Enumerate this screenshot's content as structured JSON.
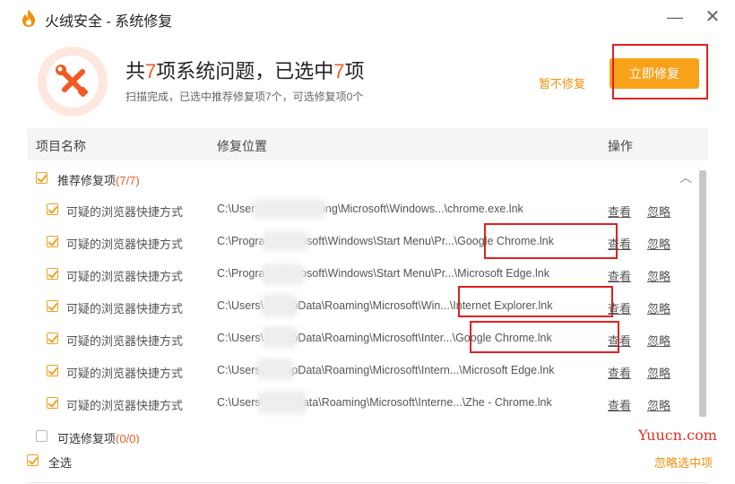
{
  "window": {
    "title": "火绒安全 - 系统修复",
    "minimize_label": "—",
    "close_label": "✕"
  },
  "summary": {
    "title_prefix": "共",
    "total": "7",
    "title_middle": "项系统问题，已选中",
    "selected": "7",
    "title_suffix": "项",
    "subtitle": "扫描完成，已选中推荐修复项7个，可选修复项0个",
    "skip_label": "暂不修复",
    "fix_label": "立即修复"
  },
  "table": {
    "columns": [
      "项目名称",
      "修复位置",
      "操作"
    ]
  },
  "groups": {
    "recommended": {
      "label": "推荐修复项",
      "count": "(7/7)"
    },
    "optional": {
      "label": "可选修复项",
      "count": "(0/0)"
    }
  },
  "rows": [
    {
      "name": "可疑的浏览器快捷方式",
      "path": "C:\\User…Data\\Roaming\\Microsoft\\Windows...\\chrome.exe.lnk",
      "view": "查看",
      "ignore": "忽略"
    },
    {
      "name": "可疑的浏览器快捷方式",
      "path": "C:\\Progra…\\Microsoft\\Windows\\Start Menu\\Pr...\\Google Chrome.lnk",
      "view": "查看",
      "ignore": "忽略"
    },
    {
      "name": "可疑的浏览器快捷方式",
      "path": "C:\\Progra…\\Microsoft\\Windows\\Start Menu\\Pr...\\Microsoft Edge.lnk",
      "view": "查看",
      "ignore": "忽略"
    },
    {
      "name": "可疑的浏览器快捷方式",
      "path": "C:\\Users\\…\\AppData\\Roaming\\Microsoft\\Win...\\Internet  Explorer.lnk",
      "view": "查看",
      "ignore": "忽略"
    },
    {
      "name": "可疑的浏览器快捷方式",
      "path": "C:\\Users\\…\\AppData\\Roaming\\Microsoft\\Inter...\\Google Chrome.lnk",
      "view": "查看",
      "ignore": "忽略"
    },
    {
      "name": "可疑的浏览器快捷方式",
      "path": "C:\\Users\\…\\AppData\\Roaming\\Microsoft\\Intern...\\Microsoft Edge.lnk",
      "view": "查看",
      "ignore": "忽略"
    },
    {
      "name": "可疑的浏览器快捷方式",
      "path": "C:\\Users\\…AppData\\Roaming\\Microsoft\\Interne...\\Zhe - Chrome.lnk",
      "view": "查看",
      "ignore": "忽略"
    }
  ],
  "footer": {
    "select_all": "全选",
    "ignore_selected": "忽略选中项"
  },
  "watermark": "Yuucn.com",
  "colors": {
    "accent": "#f15a24",
    "button": "#f8a21b",
    "link_orange": "#f0900c",
    "highlight": "#e02020"
  }
}
